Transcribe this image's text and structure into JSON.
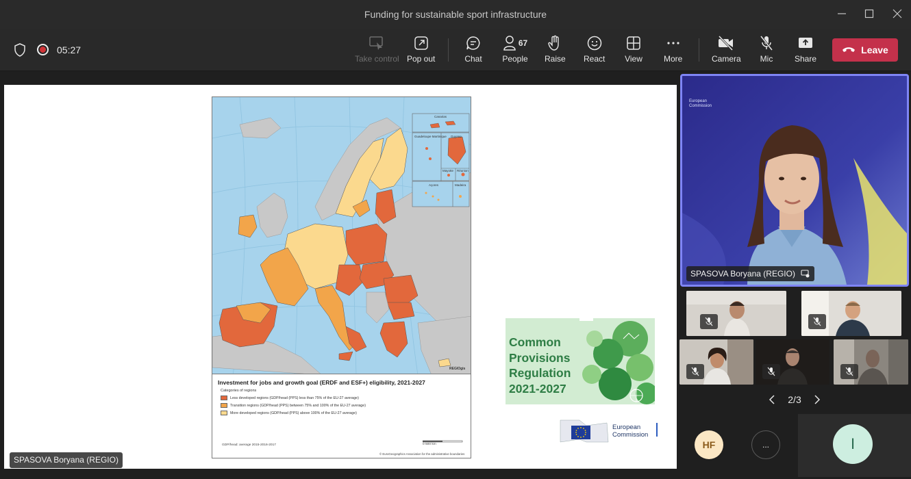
{
  "window": {
    "title": "Funding for sustainable sport infrastructure"
  },
  "toolbar": {
    "timer": "05:27",
    "take_control": "Take control",
    "pop_out": "Pop out",
    "chat": "Chat",
    "people": "People",
    "people_count": "67",
    "raise": "Raise",
    "react": "React",
    "view": "View",
    "more": "More",
    "camera": "Camera",
    "mic": "Mic",
    "share": "Share",
    "leave": "Leave"
  },
  "slide": {
    "legend_title": "Investment for jobs and growth goal (ERDF and ESF+) eligibility, 2021-2027",
    "legend_subtitle": "Categories of regions",
    "legend_items": [
      {
        "label": "Less developed regions (GDP/head (PPS) less than 75% of the EU-27 average)",
        "color": "#e2683c"
      },
      {
        "label": "Transition regions (GDP/head (PPS) between 75% and 100% of the EU-27 average)",
        "color": "#f2a54a"
      },
      {
        "label": "More developed regions (GDP/head (PPS) above 100% of the EU-27 average)",
        "color": "#fbd98e"
      }
    ],
    "legend_footnote": "GDP/head: average 2015-2016-2017",
    "scale_label": "0        500 km",
    "copyright": "© EuroGeographics Association for the administrative boundaries",
    "map_credit": "REGIOgis",
    "insets": {
      "canarias": "Canarias",
      "guadeloupe": "Guadeloupe Martinique",
      "guyane": "Guyane",
      "mayotte": "Mayotte",
      "reunion": "Réunion",
      "acores": "Açores",
      "madeira": "Madeira"
    },
    "cpr_title_lines": [
      "Common",
      "Provisions",
      "Regulation",
      "2021-2027"
    ],
    "ec_logo_lines": [
      "European",
      "Commission"
    ],
    "presenter_label": "SPASOVA Boryana (REGIO)"
  },
  "participants": {
    "speaker_name": "SPASOVA Boryana (REGIO)",
    "speaker_bg_logo": [
      "European",
      "Commission"
    ],
    "page": "2/3",
    "avatar_hf": "HF",
    "more_label": "...",
    "self_initial": "I"
  },
  "colors": {
    "leave": "#c4314b",
    "speaker_border": "#7f85f5",
    "less_developed": "#e2683c",
    "transition": "#f2a54a",
    "more_developed": "#fbd98e"
  }
}
